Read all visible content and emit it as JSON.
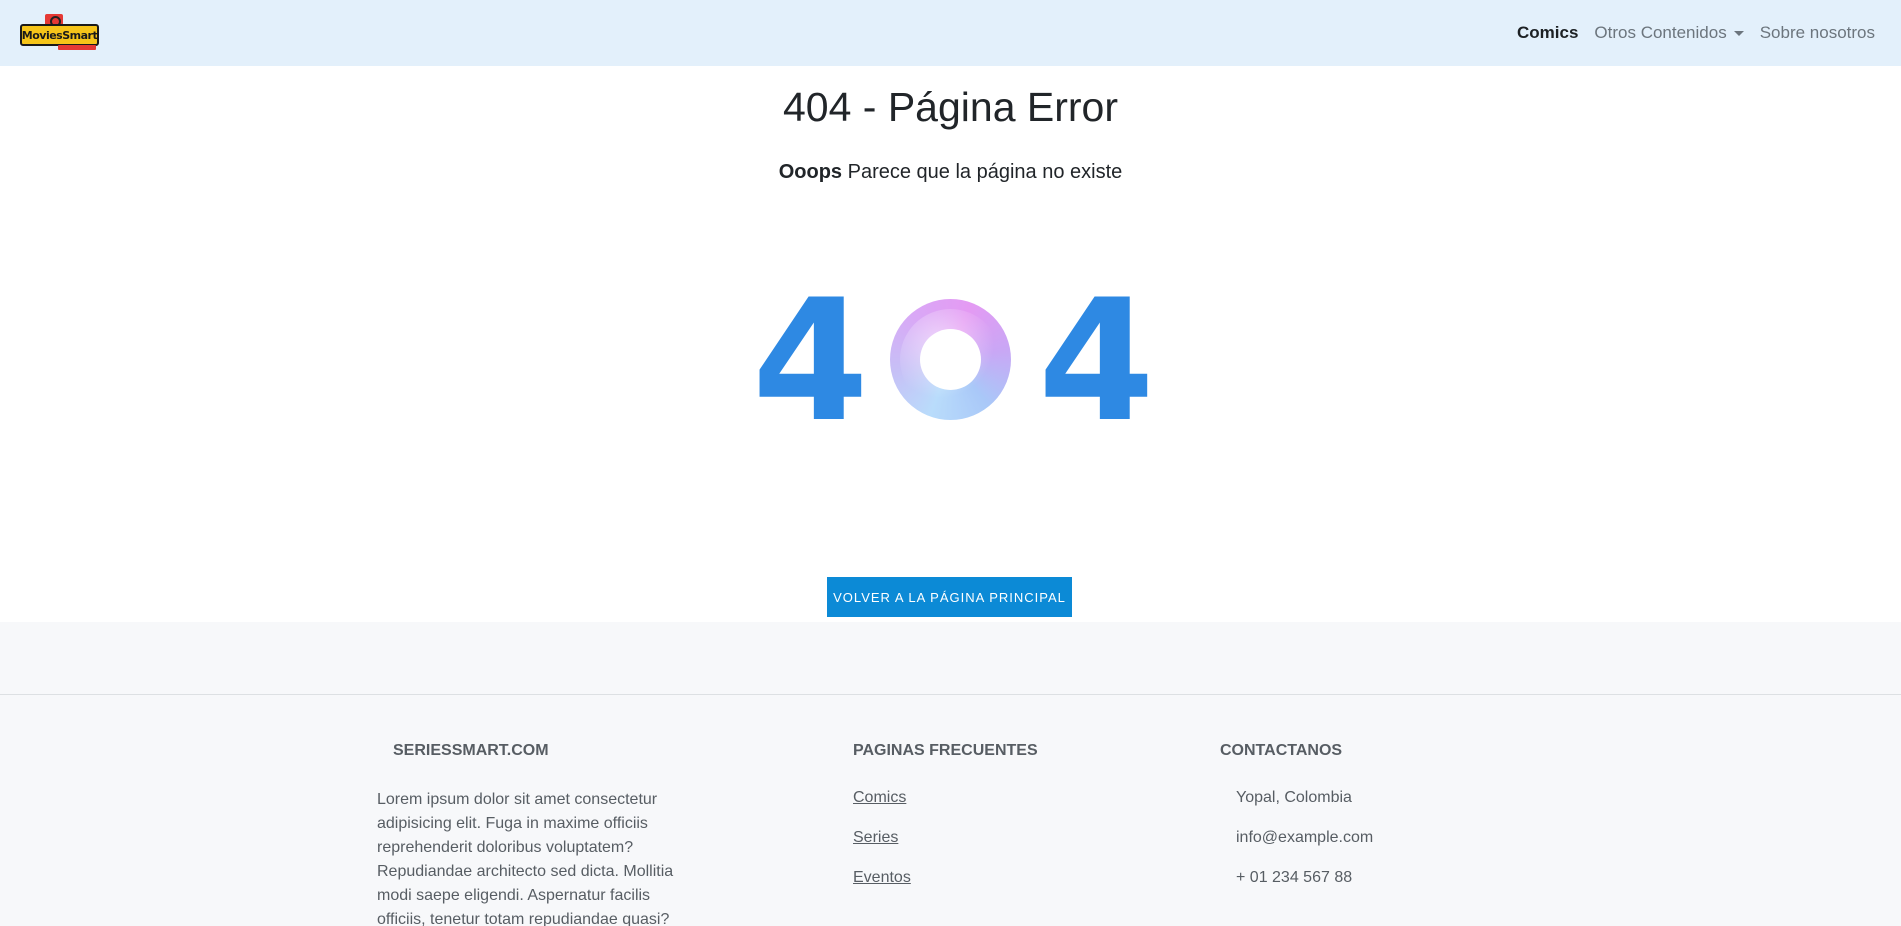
{
  "navbar": {
    "logo_text": "MoviesSmart",
    "links": [
      {
        "label": "Comics"
      },
      {
        "label": "Otros Contenidos"
      },
      {
        "label": "Sobre nosotros"
      }
    ]
  },
  "main": {
    "title": "404 - Página Error",
    "subtitle_bold": "Ooops",
    "subtitle_rest": " Parece que la página no existe",
    "digit_left": "4",
    "digit_right": "4",
    "cta_label": "Volver a la página principal"
  },
  "footer": {
    "col1": {
      "heading": "SERIESSMART.COM",
      "text": "Lorem ipsum dolor sit amet consectetur adipisicing elit. Fuga in maxime officiis reprehenderit doloribus voluptatem? Repudiandae architecto sed dicta. Mollitia modi saepe eligendi. Aspernatur facilis officiis, tenetur totam repudiandae quasi?"
    },
    "col2": {
      "heading": "PAGINAS FRECUENTES",
      "links": [
        "Comics",
        "Series",
        "Eventos"
      ]
    },
    "col3": {
      "heading": "CONTACTANOS",
      "items": [
        "Yopal, Colombia",
        "info@example.com",
        "+ 01 234 567 88"
      ]
    }
  },
  "colors": {
    "navbar_bg": "#e3f0fb",
    "digit_blue": "#2e89e3",
    "cta_bg": "#0c8ad6",
    "footer_bg": "#f7f8fa"
  }
}
